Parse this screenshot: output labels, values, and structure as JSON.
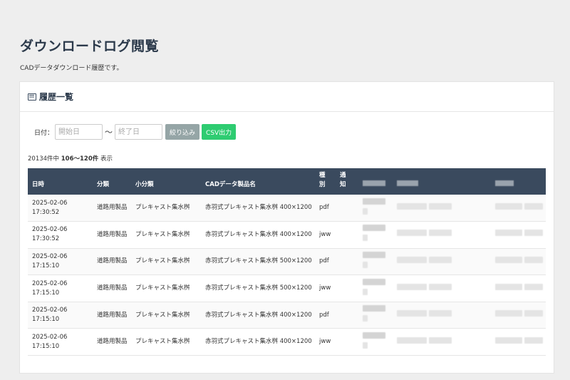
{
  "page": {
    "title": "ダウンロードログ閲覧",
    "description": "CADデータダウンロード履歴です。"
  },
  "card": {
    "icon": "list-icon",
    "title": "履歴一覧"
  },
  "filter": {
    "label": "日付：",
    "start_placeholder": "開始日",
    "separator": "～",
    "end_placeholder": "終了日",
    "filter_button": "絞り込み",
    "csv_button": "CSV出力"
  },
  "results": {
    "total_prefix": "20134件中 ",
    "range": "106～120件",
    "suffix": " 表示"
  },
  "table": {
    "headers": [
      "日時",
      "分類",
      "小分類",
      "CADデータ製品名",
      "種別",
      "通知"
    ],
    "rows": [
      {
        "date": "2025-02-06",
        "time": "17:30:52",
        "category": "道路用製品",
        "subcategory": "プレキャスト集水桝",
        "product": "赤羽式プレキャスト集水桝 400×1200",
        "type": "pdf",
        "notify": ""
      },
      {
        "date": "2025-02-06",
        "time": "17:30:52",
        "category": "道路用製品",
        "subcategory": "プレキャスト集水桝",
        "product": "赤羽式プレキャスト集水桝 400×1200",
        "type": "jww",
        "notify": ""
      },
      {
        "date": "2025-02-06",
        "time": "17:15:10",
        "category": "道路用製品",
        "subcategory": "プレキャスト集水桝",
        "product": "赤羽式プレキャスト集水桝 500×1200",
        "type": "pdf",
        "notify": ""
      },
      {
        "date": "2025-02-06",
        "time": "17:15:10",
        "category": "道路用製品",
        "subcategory": "プレキャスト集水桝",
        "product": "赤羽式プレキャスト集水桝 500×1200",
        "type": "jww",
        "notify": ""
      },
      {
        "date": "2025-02-06",
        "time": "17:15:10",
        "category": "道路用製品",
        "subcategory": "プレキャスト集水桝",
        "product": "赤羽式プレキャスト集水桝 400×1200",
        "type": "pdf",
        "notify": ""
      },
      {
        "date": "2025-02-06",
        "time": "17:15:10",
        "category": "道路用製品",
        "subcategory": "プレキャスト集水桝",
        "product": "赤羽式プレキャスト集水桝 400×1200",
        "type": "jww",
        "notify": ""
      }
    ]
  },
  "colors": {
    "header_bg": "#3a4a5e",
    "title": "#2c3a4b",
    "filter_button": "#95a5a6",
    "csv_button": "#2ecc71"
  }
}
